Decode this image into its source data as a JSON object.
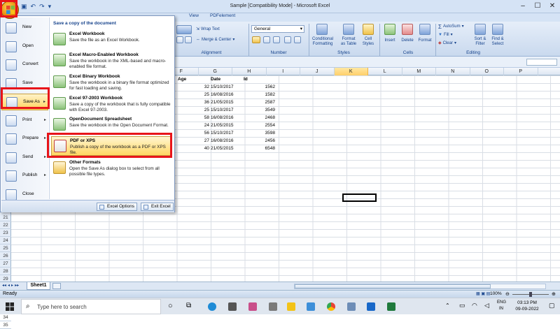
{
  "window": {
    "title": "Sample  [Compatibility Mode] - Microsoft Excel"
  },
  "ribbon": {
    "tabs": [
      "View",
      "PDFelement"
    ],
    "alignment": {
      "wrap_text": "Wrap Text",
      "merge_center": "Merge & Center",
      "group": "Alignment"
    },
    "number": {
      "format": "General",
      "group": "Number"
    },
    "styles": {
      "conditional": "Conditional\nFormatting",
      "format_table": "Format\nas Table",
      "cell_styles": "Cell\nStyles",
      "group": "Styles"
    },
    "cells": {
      "insert": "Insert",
      "delete": "Delete",
      "format": "Format",
      "group": "Cells"
    },
    "editing": {
      "autosum": "AutoSum",
      "fill": "Fill",
      "clear": "Clear",
      "sort": "Sort &\nFilter",
      "find": "Find &\nSelect",
      "group": "Editing"
    }
  },
  "sheet": {
    "columns": [
      "Age",
      "Date",
      "Id"
    ],
    "col_letters": [
      "F",
      "G",
      "H",
      "I",
      "J",
      "K",
      "L",
      "M",
      "N",
      "O",
      "P"
    ],
    "selected_col": "K",
    "rows": [
      {
        "age": "32",
        "date": "15/10/2017",
        "id": "1562"
      },
      {
        "age": "25",
        "date": "16/08/2016",
        "id": "1582"
      },
      {
        "age": "36",
        "date": "21/05/2015",
        "id": "2587"
      },
      {
        "age": "25",
        "date": "15/10/2017",
        "id": "3549"
      },
      {
        "age": "58",
        "date": "16/08/2016",
        "id": "2468"
      },
      {
        "age": "24",
        "date": "21/05/2015",
        "id": "2554"
      },
      {
        "age": "56",
        "date": "15/10/2017",
        "id": "3598"
      },
      {
        "age": "27",
        "date": "16/08/2016",
        "id": "2456"
      },
      {
        "age": "40",
        "date": "21/05/2015",
        "id": "6548"
      }
    ],
    "row_numbers": [
      "21",
      "22",
      "23",
      "24",
      "25",
      "26",
      "27",
      "28",
      "29",
      "30",
      "31",
      "32",
      "33",
      "34",
      "35"
    ],
    "sheet_tab": "Sheet1",
    "status": "Ready",
    "zoom": "100%"
  },
  "menu": {
    "left": [
      "New",
      "Open",
      "Convert",
      "Save",
      "Save As",
      "Print",
      "Prepare",
      "Send",
      "Publish",
      "Close"
    ],
    "right_title": "Save a copy of the document",
    "options": [
      {
        "title": "Excel Workbook",
        "desc": "Save the file as an Excel Workbook."
      },
      {
        "title": "Excel Macro-Enabled Workbook",
        "desc": "Save the workbook in the XML-based and macro-enabled file format."
      },
      {
        "title": "Excel Binary Workbook",
        "desc": "Save the workbook in a binary file format optimized for fast loading and saving."
      },
      {
        "title": "Excel 97-2003 Workbook",
        "desc": "Save a copy of the workbook that is fully compatible with Excel 97-2003."
      },
      {
        "title": "OpenDocument Spreadsheet",
        "desc": "Save the workbook in the Open Document Format."
      },
      {
        "title": "PDF or XPS",
        "desc": "Publish a copy of the workbook as a PDF or XPS file."
      },
      {
        "title": "Other Formats",
        "desc": "Open the Save As dialog box to select from all possible file types."
      }
    ],
    "excel_options": "Excel Options",
    "exit_excel": "Exit Excel"
  },
  "taskbar": {
    "search_placeholder": "Type here to search",
    "lang1": "ENG",
    "lang2": "IN",
    "time": "03:13 PM",
    "date": "09-09-2022"
  },
  "colors": {
    "accent": "#15428b",
    "highlight": "#ffd35c",
    "annotation": "#e8141a"
  }
}
